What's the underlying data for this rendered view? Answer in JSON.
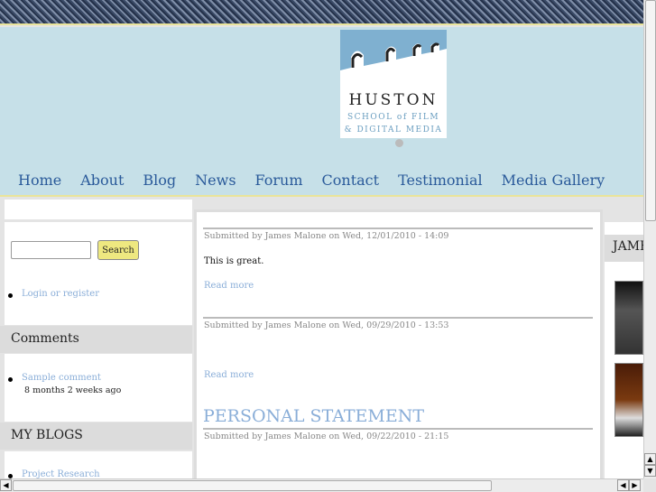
{
  "logo": {
    "line1": "HUSTON",
    "line2": "SCHOOL of FILM",
    "line3": "& DIGITAL MEDIA"
  },
  "nav": [
    "Home",
    "About",
    "Blog",
    "News",
    "Forum",
    "Contact",
    "Testimonial",
    "Media Gallery"
  ],
  "search": {
    "button": "Search",
    "value": ""
  },
  "sidebar": {
    "login": "Login or register",
    "comments_title": "Comments",
    "comment": "Sample comment",
    "comment_age": "8 months 2 weeks ago",
    "blogs_title": "MY BLOGS",
    "blog_item": "Project Research"
  },
  "posts": [
    {
      "meta": "Submitted by James Malone on Wed, 12/01/2010 - 14:09",
      "body": "This is great.",
      "read_more": "Read more"
    },
    {
      "meta": "Submitted by James Malone on Wed, 09/29/2010 - 13:53",
      "read_more": "Read more"
    },
    {
      "title": "PERSONAL STATEMENT",
      "meta": "Submitted by James Malone on Wed, 09/22/2010 - 21:15"
    }
  ],
  "right": {
    "title": "JAMES MALONE"
  }
}
